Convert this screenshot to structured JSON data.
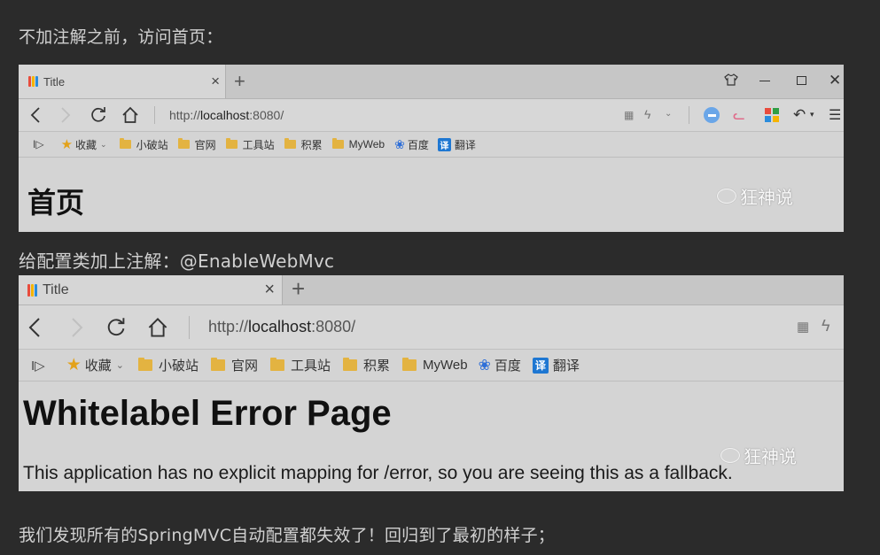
{
  "paragraphs": {
    "p1": "不加注解之前，访问首页：",
    "p2": "给配置类加上注解：@EnableWebMvc",
    "p3": "我们发现所有的SpringMVC自动配置都失效了！回归到了最初的样子；"
  },
  "browser": {
    "tab_title": "Title",
    "tab_close": "×",
    "new_tab": "+",
    "url_prefix": "http://",
    "url_host": "localhost",
    "url_suffix": ":8080/",
    "bookmarks": {
      "sidebar": "I▷",
      "favorites": "收藏",
      "folders": [
        "小破站",
        "官网",
        "工具站",
        "积累",
        "MyWeb"
      ],
      "baidu": "百度",
      "translate_icon": "译",
      "translate": "翻译"
    },
    "icons": {
      "back": "back-icon",
      "forward": "forward-icon",
      "reload": "reload-icon",
      "home": "home-icon",
      "qr": "qr-icon",
      "bolt": "bolt-icon"
    }
  },
  "screenshot1": {
    "heading": "首页",
    "watermark": "狂神说"
  },
  "screenshot2": {
    "heading": "Whitelabel Error Page",
    "message": "This application has no explicit mapping for /error, so you are seeing this as a fallback.",
    "watermark": "狂神说"
  },
  "colors": {
    "page_bg": "#2b2b2b",
    "browser_chrome": "#c6c6c6",
    "browser_content": "#d4d4d4",
    "folder": "#e3b341",
    "translate_blue": "#1e77d2"
  }
}
